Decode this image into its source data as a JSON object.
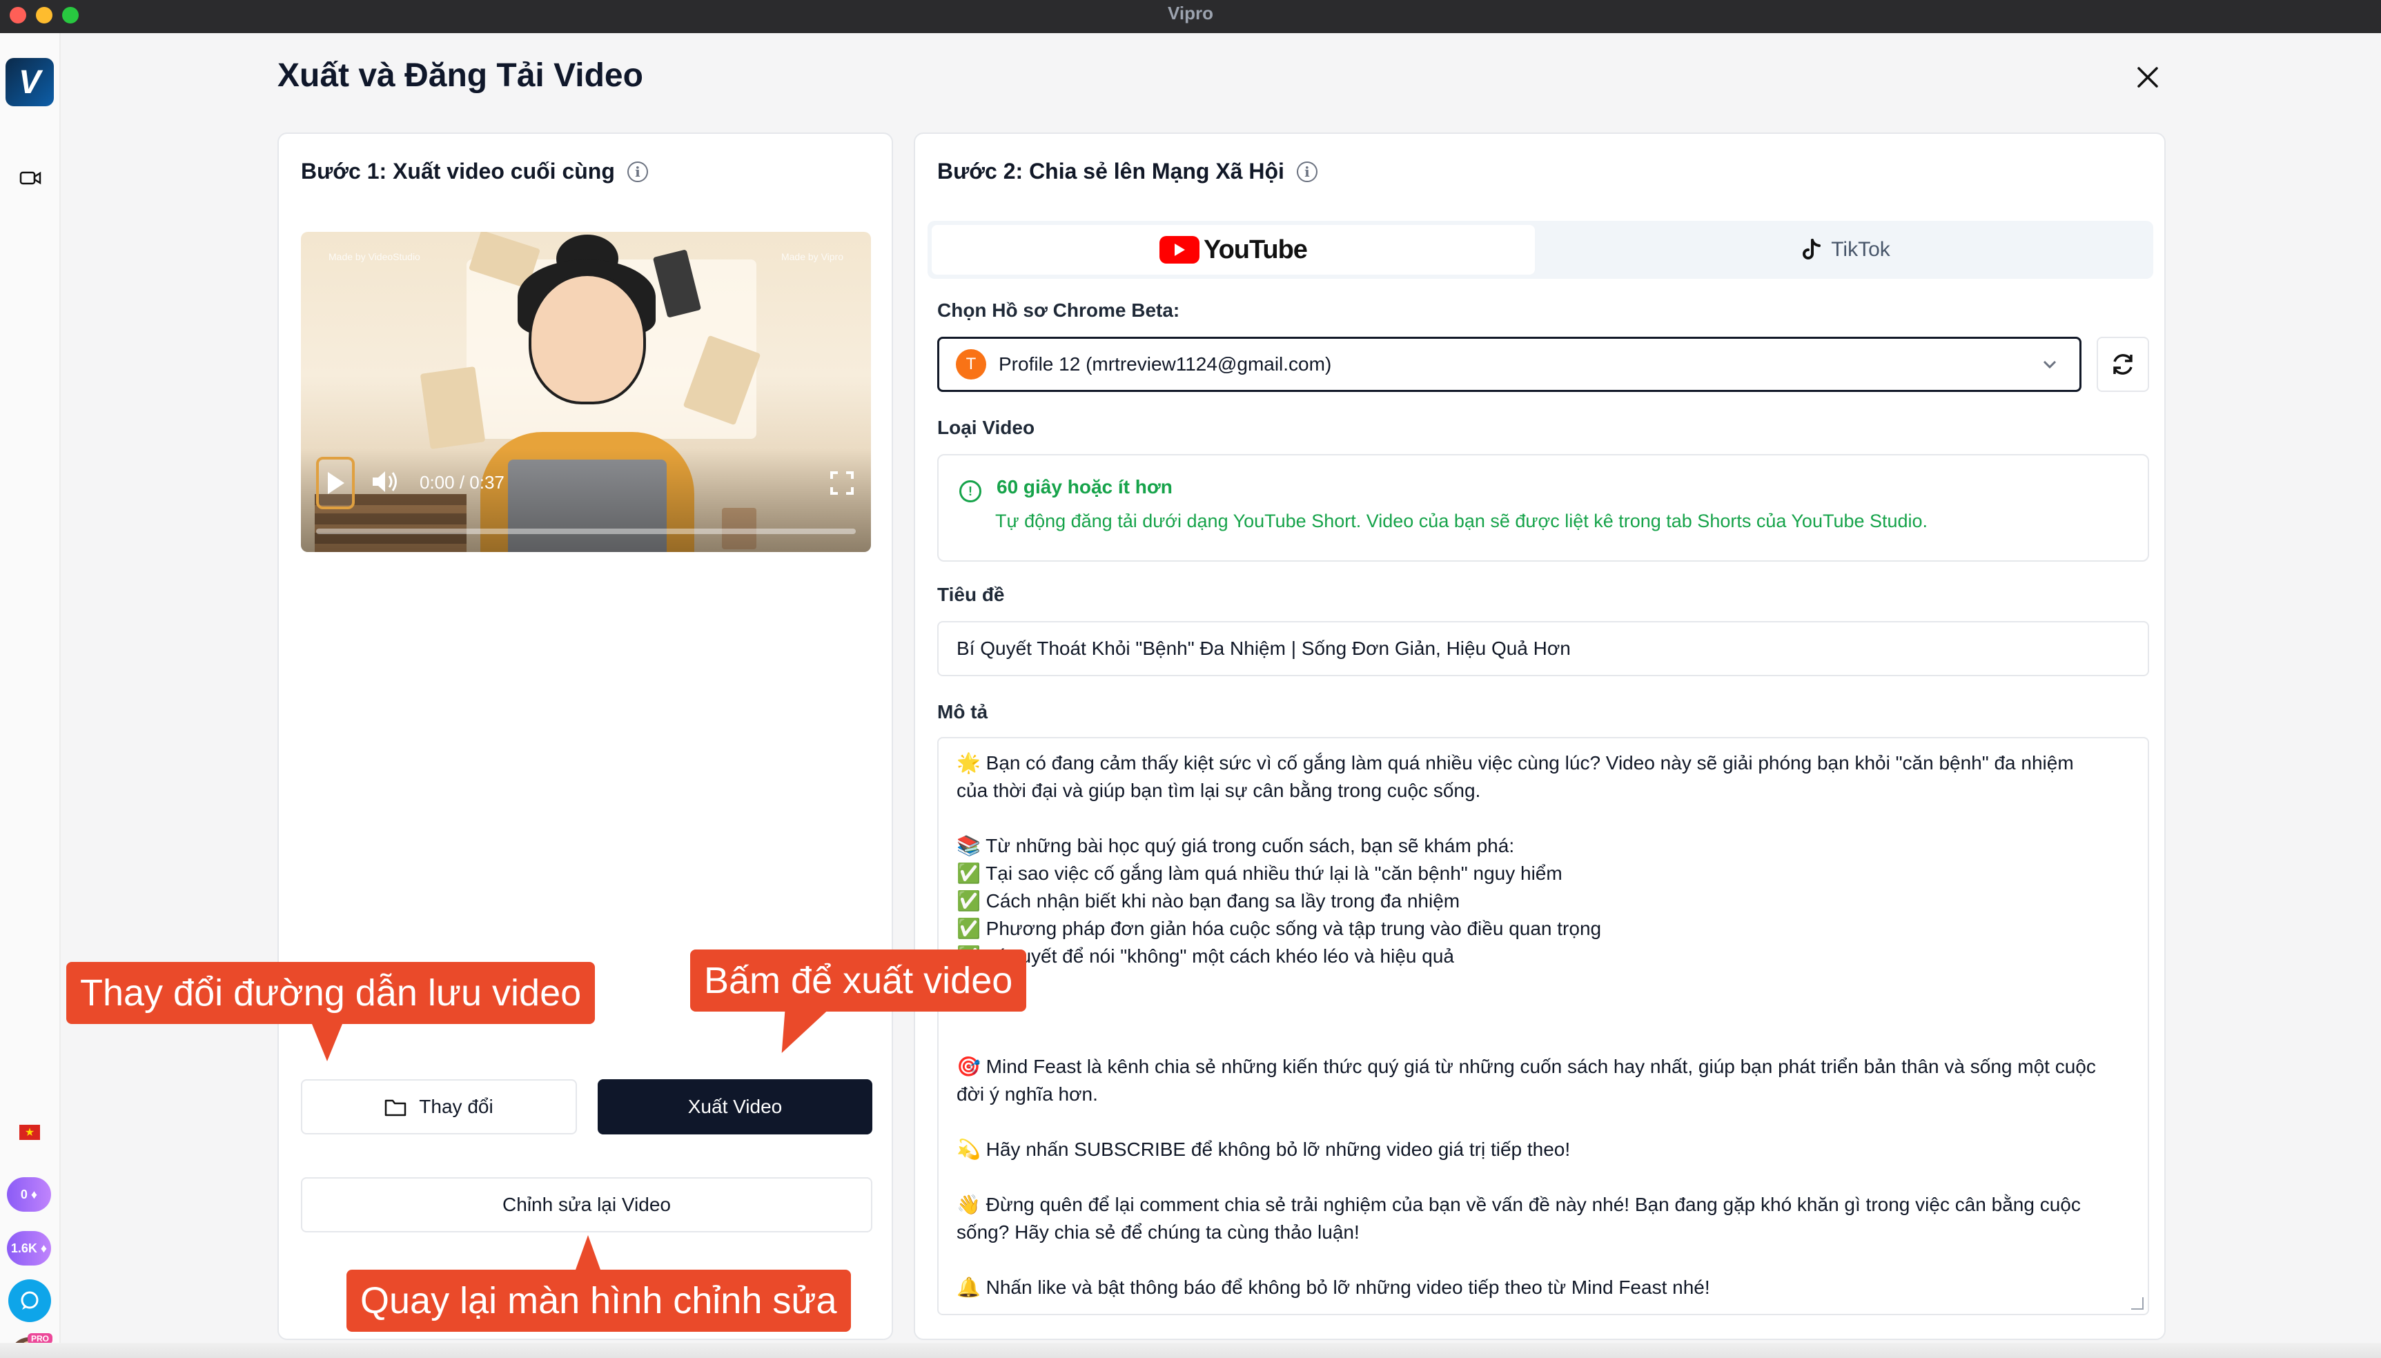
{
  "window": {
    "title": "Vipro"
  },
  "sidebar": {
    "logo_letter": "V",
    "credits_a": "0",
    "credits_b": "1.6K",
    "pro_label": "PRO"
  },
  "header": {
    "title": "Xuất và Đăng Tải Video",
    "close_glyph": "✕"
  },
  "step1": {
    "heading": "Bước 1: Xuất video cuối cùng",
    "video": {
      "watermark_left": "Made by VideoStudio",
      "watermark_right": "Made by Vipro",
      "time": "0:00 / 0:37",
      "progress": 0
    },
    "change_button": "Thay đổi",
    "export_button": "Xuất Video",
    "edit_button": "Chỉnh sửa lại Video"
  },
  "callouts": {
    "change_path": "Thay đổi đường dẫn lưu video",
    "export": "Bấm để xuất video",
    "back_to_edit": "Quay lại màn hình chỉnh sửa"
  },
  "step2": {
    "heading": "Bước 2: Chia sẻ lên Mạng Xã Hội",
    "tabs": {
      "youtube": "YouTube",
      "tiktok": "TikTok"
    },
    "profile_label": "Chọn Hồ sơ Chrome Beta:",
    "profile_initial": "T",
    "profile_value": "Profile 12 (mrtreview1124@gmail.com)",
    "video_type_label": "Loại Video",
    "video_type_title": "60 giây hoặc ít hơn",
    "video_type_desc": "Tự động đăng tải dưới dạng YouTube Short. Video của bạn sẽ được liệt kê trong tab Shorts của YouTube Studio.",
    "title_label": "Tiêu đề",
    "title_value": "Bí Quyết Thoát Khỏi \"Bệnh\" Đa Nhiệm | Sống Đơn Giản, Hiệu Quả Hơn",
    "description_label": "Mô tả",
    "description_lines": [
      "🌟 Bạn có đang cảm thấy kiệt sức vì cố gắng làm quá nhiều việc cùng lúc? Video này sẽ giải phóng bạn khỏi \"căn bệnh\" đa nhiệm",
      "của thời đại và giúp bạn tìm lại sự cân bằng trong cuộc sống.",
      "",
      "📚 Từ những bài học quý giá trong cuốn sách, bạn sẽ khám phá:",
      "✅ Tại sao việc cố gắng làm quá nhiều thứ lại là \"căn bệnh\" nguy hiểm",
      "✅ Cách nhận biết khi nào bạn đang sa lầy trong đa nhiệm",
      "✅ Phương pháp đơn giản hóa cuộc sống và tập trung vào điều quan trọng",
      "✅ Bí quyết để nói \"không\" một cách khéo léo và hiệu quả",
      "",
      "",
      "",
      "🎯 Mind Feast là kênh chia sẻ những kiến thức quý giá từ những cuốn sách hay nhất, giúp bạn phát triển bản thân và sống một cuộc",
      "đời ý nghĩa hơn.",
      "",
      "💫 Hãy nhấn SUBSCRIBE để không bỏ lỡ những video giá trị tiếp theo!",
      "",
      "👋 Đừng quên để lại comment chia sẻ trải nghiệm của bạn về vấn đề này nhé! Bạn đang gặp khó khăn gì trong việc cân bằng cuộc",
      "sống? Hãy chia sẻ để chúng ta cùng thảo luận!",
      "",
      "🔔 Nhấn like và bật thông báo để không bỏ lỡ những video tiếp theo từ Mind Feast nhé!"
    ]
  },
  "colors": {
    "accent_dark": "#0f172a",
    "callout": "#ea4a2a",
    "success": "#16a34a",
    "youtube_red": "#ff0000"
  }
}
